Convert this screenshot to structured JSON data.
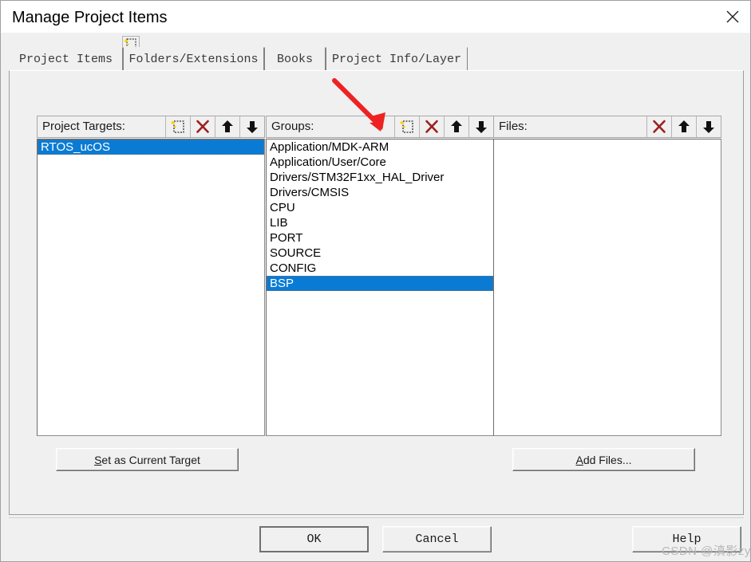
{
  "window": {
    "title": "Manage Project Items",
    "close_icon": "close-icon"
  },
  "tabs": [
    {
      "label": "Project Items",
      "active": true
    },
    {
      "label": "Folders/Extensions",
      "active": false
    },
    {
      "label": "Books",
      "active": false
    },
    {
      "label": "Project Info/Layer",
      "active": false
    }
  ],
  "columns": {
    "targets": {
      "label": "Project Targets:",
      "tools": [
        "new-item-icon",
        "delete-icon",
        "move-up-icon",
        "move-down-icon"
      ],
      "items": [
        "RTOS_ucOS"
      ],
      "selected_index": 0
    },
    "groups": {
      "label": "Groups:",
      "tools": [
        "new-item-icon",
        "delete-icon",
        "move-up-icon",
        "move-down-icon"
      ],
      "items": [
        "Application/MDK-ARM",
        "Application/User/Core",
        "Drivers/STM32F1xx_HAL_Driver",
        "Drivers/CMSIS",
        "CPU",
        "LIB",
        "PORT",
        "SOURCE",
        "CONFIG",
        "BSP"
      ],
      "selected_index": 9
    },
    "files": {
      "label": "Files:",
      "tools": [
        "delete-icon",
        "move-up-icon",
        "move-down-icon"
      ],
      "items": [],
      "selected_index": -1
    }
  },
  "actions": {
    "set_current_target": {
      "prefix": "",
      "accel": "S",
      "rest": "et as Current Target"
    },
    "add_files": {
      "prefix": "",
      "accel": "A",
      "rest": "dd Files..."
    }
  },
  "dialog_buttons": {
    "ok": "OK",
    "cancel": "Cancel",
    "help": "Help"
  },
  "annotation": {
    "arrow_color": "#ee2222",
    "points_to": "groups-new-item-button"
  },
  "watermark": "CSDN @滇影zy",
  "colors": {
    "selection_blue": "#0a7bd4",
    "dialog_face": "#f0f0f0",
    "list_background": "#ffffff",
    "delete_icon_red": "#9e1f1f",
    "annotation_red": "#ee2222"
  }
}
